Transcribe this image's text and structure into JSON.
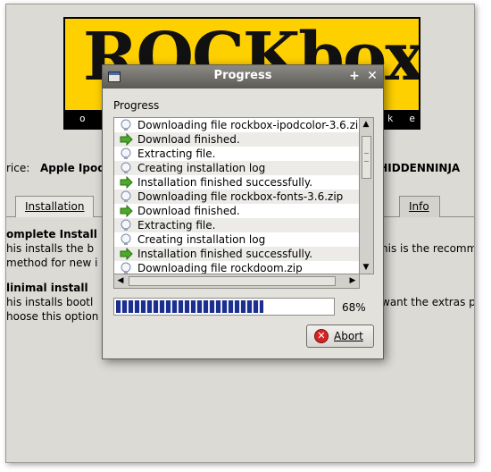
{
  "app": {
    "logo_text": "ROCKbox",
    "logo_strip": "open source jukebox firmware",
    "device_label": "rice:",
    "device_value": "Apple Ipod",
    "device_right": "WHIDDENNINJA",
    "tabs": [
      {
        "label": "Installation"
      },
      {
        "label": "Info"
      }
    ],
    "complete_heading": "omplete Install",
    "complete_line1": "his installs the b",
    "complete_line1_right": "his is the recomm",
    "complete_line2": "method for new i",
    "minimal_heading": "linimal install",
    "minimal_line1": "his installs bootl",
    "minimal_line1_right": "want the extras p",
    "minimal_line2": "hoose this option"
  },
  "dialog": {
    "title": "Progress",
    "title_buttons": [
      "+",
      "✕"
    ],
    "label": "Progress",
    "log": [
      {
        "text": "Downloading file rockbox-ipodcolor-3.6.zip",
        "icon": "info-icon"
      },
      {
        "text": "Download finished.",
        "icon": "ok-arrow-icon"
      },
      {
        "text": "Extracting file.",
        "icon": "info-icon"
      },
      {
        "text": "Creating installation log",
        "icon": "info-icon"
      },
      {
        "text": "Installation finished successfully.",
        "icon": "ok-arrow-icon"
      },
      {
        "text": "Downloading file rockbox-fonts-3.6.zip",
        "icon": "info-icon"
      },
      {
        "text": "Download finished.",
        "icon": "ok-arrow-icon"
      },
      {
        "text": "Extracting file.",
        "icon": "info-icon"
      },
      {
        "text": "Creating installation log",
        "icon": "info-icon"
      },
      {
        "text": "Installation finished successfully.",
        "icon": "ok-arrow-icon"
      },
      {
        "text": "Downloading file rockdoom.zip",
        "icon": "info-icon"
      }
    ],
    "progress_value": 0.68,
    "progress_text": "68%",
    "abort_label": "Abort"
  },
  "colors": {
    "logo_bg": "#ffd000",
    "progress_fill": "#1b2f8c",
    "abort_icon": "#d42424"
  }
}
